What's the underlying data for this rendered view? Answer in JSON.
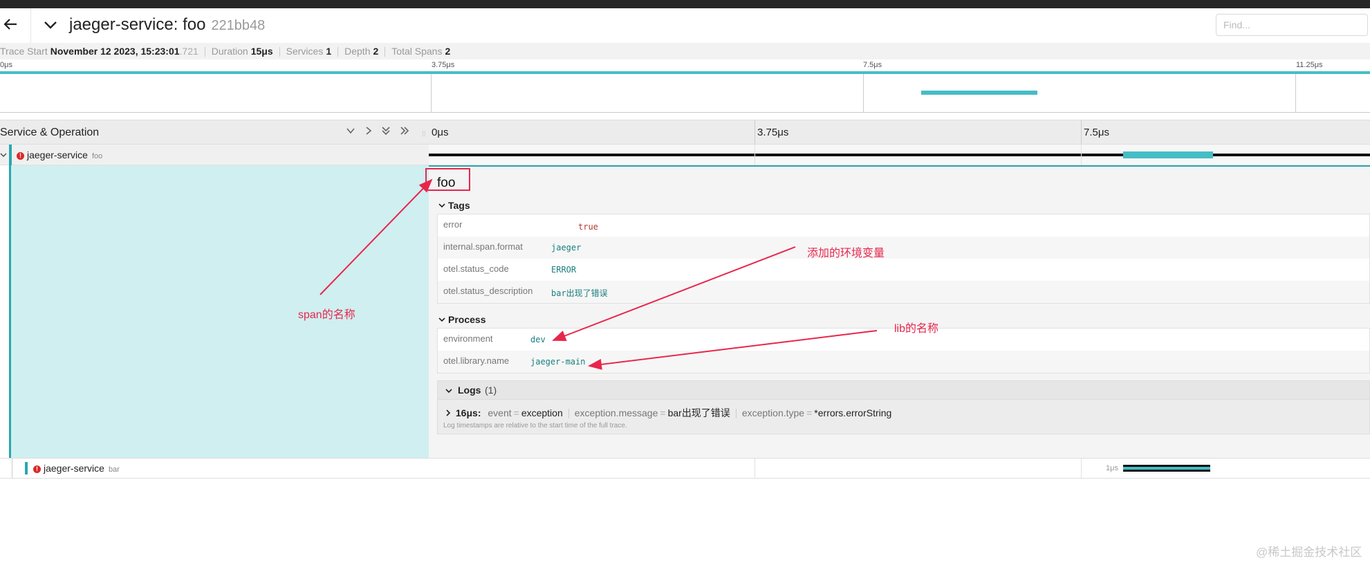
{
  "header": {
    "title": "jaeger-service: foo",
    "trace_id": "221bb48",
    "find_placeholder": "Find..."
  },
  "summary": {
    "trace_start_label": "Trace Start",
    "trace_start_value": "November 12 2023, 15:23:01",
    "trace_start_ms": ".721",
    "duration_label": "Duration",
    "duration_value": "15μs",
    "services_label": "Services",
    "services_value": "1",
    "depth_label": "Depth",
    "depth_value": "2",
    "total_spans_label": "Total Spans",
    "total_spans_value": "2"
  },
  "minimap_ticks": [
    "0μs",
    "3.75μs",
    "7.5μs",
    "11.25μs"
  ],
  "timeline_header": {
    "label": "Service & Operation",
    "ticks": [
      "0μs",
      "3.75μs",
      "7.5μs"
    ]
  },
  "spans": [
    {
      "service": "jaeger-service",
      "operation": "foo"
    },
    {
      "service": "jaeger-service",
      "operation": "bar",
      "duration_label": "1μs"
    }
  ],
  "detail": {
    "span_name": "foo",
    "tags_title": "Tags",
    "tags": [
      {
        "key": "error",
        "value": "true"
      },
      {
        "key": "internal.span.format",
        "value": "jaeger"
      },
      {
        "key": "otel.status_code",
        "value": "ERROR"
      },
      {
        "key": "otel.status_description",
        "value": "bar出现了错误"
      }
    ],
    "process_title": "Process",
    "process": [
      {
        "key": "environment",
        "value": "dev"
      },
      {
        "key": "otel.library.name",
        "value": "jaeger-main"
      }
    ],
    "logs_title": "Logs",
    "logs_count": "(1)",
    "log": {
      "time": "16μs:",
      "event_key": "event",
      "event_value": "exception",
      "msg_key": "exception.message",
      "msg_value": "bar出现了错误",
      "type_key": "exception.type",
      "type_value": "*errors.errorString",
      "equals": "="
    },
    "log_note": "Log timestamps are relative to the start time of the full trace."
  },
  "annotations": {
    "span_name": "span的名称",
    "env_var": "添加的环境变量",
    "lib_name": "lib的名称"
  },
  "watermark": "@稀土掘金技术社区",
  "colors": {
    "accent": "#45bdc5",
    "error": "#db2828",
    "annotation": "#e8264c",
    "detail_bg": "#d0eff0"
  }
}
